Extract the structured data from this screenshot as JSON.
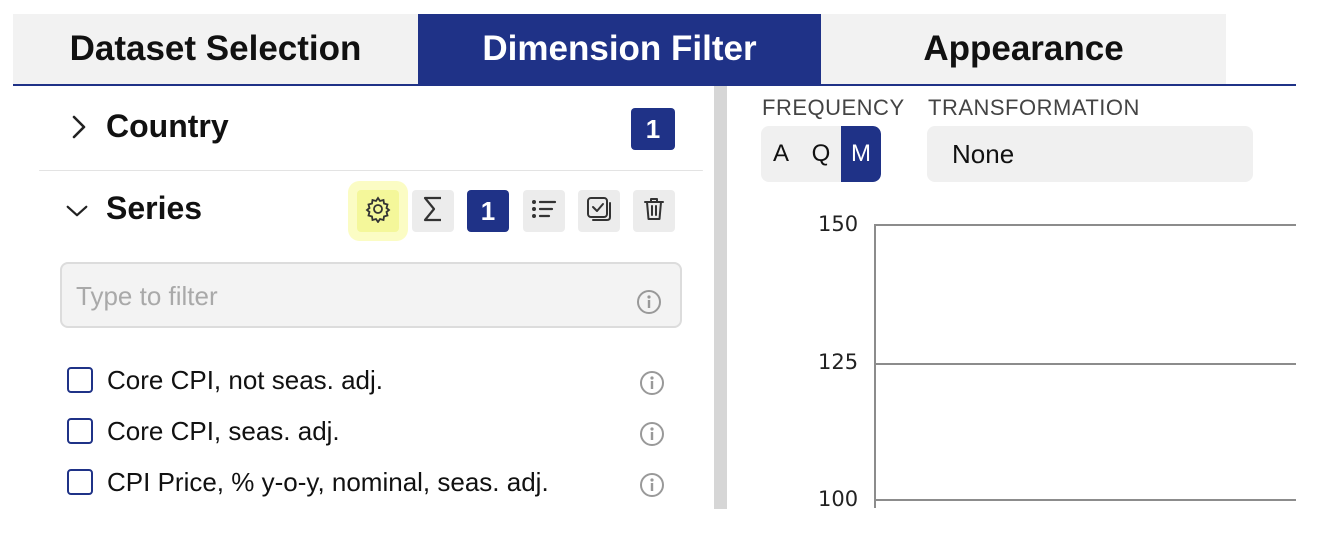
{
  "tabs": [
    {
      "label": "Dataset Selection",
      "active": false
    },
    {
      "label": "Dimension Filter",
      "active": true
    },
    {
      "label": "Appearance",
      "active": false
    }
  ],
  "country": {
    "title": "Country",
    "count": "1",
    "expanded": false
  },
  "series": {
    "title": "Series",
    "count": "1",
    "expanded": true,
    "tools": [
      "gear-icon",
      "sigma-icon",
      "list-icon",
      "select-all-icon",
      "trash-icon"
    ],
    "filter_placeholder": "Type to filter",
    "items": [
      {
        "label": "Core CPI, not seas. adj.",
        "checked": false
      },
      {
        "label": "Core CPI, seas. adj.",
        "checked": false
      },
      {
        "label": "CPI Price, % y-o-y, nominal, seas. adj.",
        "checked": false
      }
    ]
  },
  "controls": {
    "frequency_label": "FREQUENCY",
    "frequency_options": [
      "A",
      "Q",
      "M"
    ],
    "frequency_selected": "M",
    "transformation_label": "TRANSFORMATION",
    "transformation_value": "None"
  },
  "chart_data": {
    "type": "line",
    "y_ticks": [
      "150",
      "125",
      "100"
    ],
    "ylim": [
      100,
      150
    ],
    "grid": true,
    "series": []
  },
  "colors": {
    "accent": "#1f3287",
    "highlight": "#f4f79a"
  }
}
